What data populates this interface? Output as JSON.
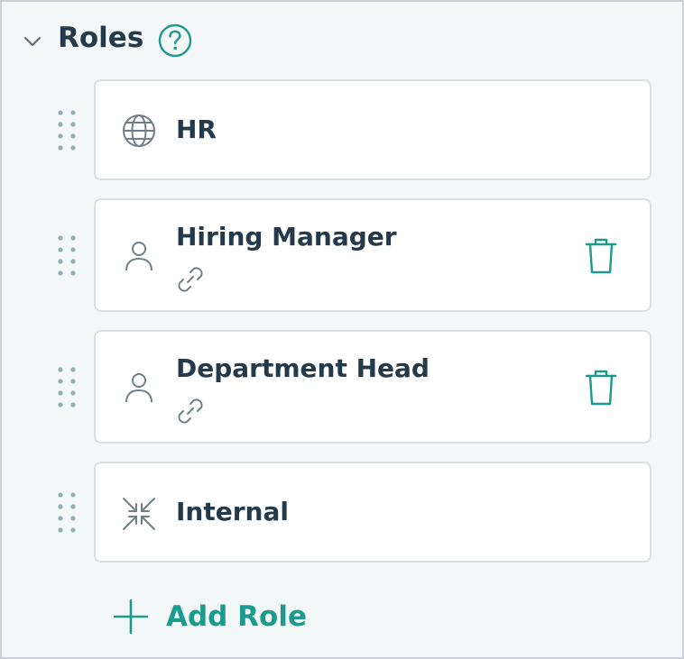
{
  "section": {
    "title": "Roles"
  },
  "roles": [
    {
      "label": "HR",
      "icon": "globe-icon",
      "linked": false,
      "deletable": false
    },
    {
      "label": "Hiring Manager",
      "icon": "user-icon",
      "linked": true,
      "deletable": true
    },
    {
      "label": "Department Head",
      "icon": "user-icon",
      "linked": true,
      "deletable": true
    },
    {
      "label": "Internal",
      "icon": "internal-icon",
      "linked": false,
      "deletable": false
    }
  ],
  "add_button": {
    "label": "Add Role",
    "icon": "plus-icon"
  },
  "colors": {
    "accent": "#1c9a8e",
    "text": "#24394a",
    "icon_gray": "#6f7f88",
    "panel_bg": "#f4f7f8",
    "card_border": "#d8dfe3"
  }
}
